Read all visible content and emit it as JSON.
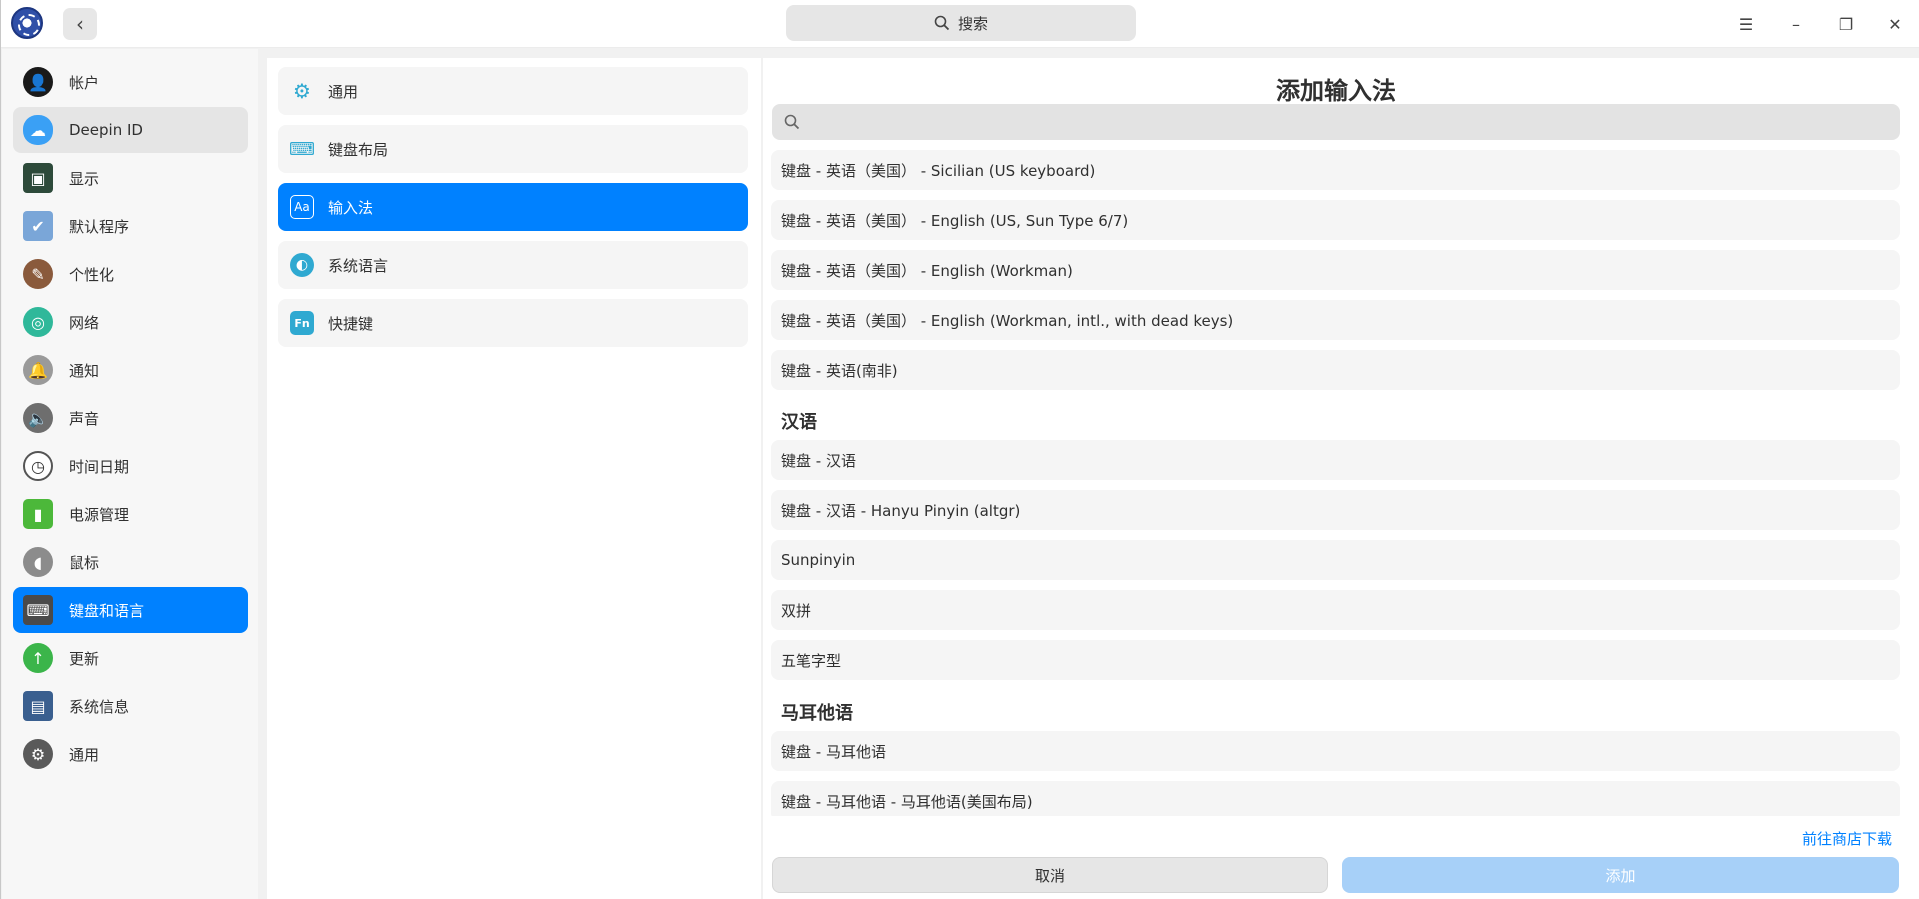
{
  "titlebar": {
    "search_label": "搜索",
    "icons": [
      "app-logo",
      "back-arrow-icon",
      "search-icon",
      "menu-icon",
      "minimize-icon",
      "maximize-icon",
      "close-icon"
    ]
  },
  "sidebar": {
    "items": [
      {
        "label": "帐户",
        "icon": "account-icon"
      },
      {
        "label": "Deepin ID",
        "icon": "cloud-icon"
      },
      {
        "label": "显示",
        "icon": "display-icon"
      },
      {
        "label": "默认程序",
        "icon": "default-apps-icon"
      },
      {
        "label": "个性化",
        "icon": "personalization-icon"
      },
      {
        "label": "网络",
        "icon": "network-icon"
      },
      {
        "label": "通知",
        "icon": "bell-icon"
      },
      {
        "label": "声音",
        "icon": "speaker-icon"
      },
      {
        "label": "时间日期",
        "icon": "clock-icon"
      },
      {
        "label": "电源管理",
        "icon": "battery-icon"
      },
      {
        "label": "鼠标",
        "icon": "mouse-icon"
      },
      {
        "label": "键盘和语言",
        "icon": "keyboard-icon"
      },
      {
        "label": "更新",
        "icon": "update-icon"
      },
      {
        "label": "系统信息",
        "icon": "system-info-icon"
      },
      {
        "label": "通用",
        "icon": "general-icon"
      }
    ],
    "hover_item": "Deepin ID",
    "active_item": "键盘和语言"
  },
  "middle": {
    "items": [
      {
        "label": "通用",
        "icon": "gear-icon"
      },
      {
        "label": "键盘布局",
        "icon": "keyboard-layout-icon"
      },
      {
        "label": "输入法",
        "icon": "input-method-icon"
      },
      {
        "label": "系统语言",
        "icon": "language-icon"
      },
      {
        "label": "快捷键",
        "icon": "shortcut-fn-icon"
      }
    ],
    "active_item": "输入法"
  },
  "dialog": {
    "title": "添加输入法",
    "filter_placeholder": "",
    "rows": [
      "键盘 - 英语（美国） - Sicilian (US keyboard)",
      "键盘 - 英语（美国） - English (US, Sun Type 6/7)",
      "键盘 - 英语（美国） - English (Workman)",
      "键盘 - 英语（美国） - English (Workman, intl., with dead keys)",
      "键盘 - 英语(南非)"
    ],
    "group_chinese": "汉语",
    "rows_chinese": [
      "键盘 - 汉语",
      "键盘 - 汉语 - Hanyu Pinyin (altgr)",
      "Sunpinyin",
      "双拼",
      "五笔字型"
    ],
    "group_maltese": "马耳他语",
    "rows_maltese": [
      "键盘 - 马耳他语",
      "键盘 - 马耳他语 - 马耳他语(美国布局)"
    ],
    "store_link": "前往商店下载",
    "cancel_label": "取消",
    "add_label": "添加"
  }
}
